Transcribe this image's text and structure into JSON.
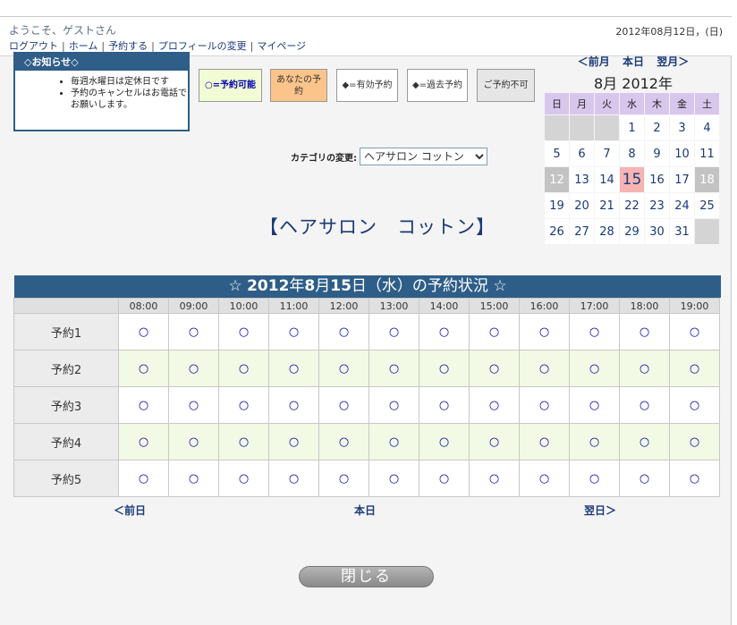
{
  "header": {
    "welcome": "ようこそ、ゲストさん",
    "date": "2012年08月12日，(日)",
    "nav": [
      "ログアウト",
      "ホーム",
      "予約する",
      "プロフィールの変更",
      "マイページ"
    ]
  },
  "notice": {
    "title": "◇お知らせ◇",
    "items": [
      "毎週水曜日は定休日です",
      "予約のキャンセルはお電話でお願いします。"
    ]
  },
  "legend": [
    "○=予約可能",
    "あなたの予約",
    "◆=有効予約",
    "◆=過去予約",
    "ご予約不可"
  ],
  "category": {
    "label": "カテゴリの変更:",
    "selected": "ヘアサロン コットン"
  },
  "salon_name": "【ヘアサロン　コットン】",
  "calendar": {
    "prev": "＜前月",
    "current": "本日",
    "next": "翌月＞",
    "title": "8月 2012年",
    "weekdays": [
      "日",
      "月",
      "火",
      "水",
      "木",
      "金",
      "土"
    ],
    "weeks": [
      [
        "",
        "",
        "",
        "1",
        "2",
        "3",
        "4"
      ],
      [
        "5",
        "6",
        "7",
        "8",
        "9",
        "10",
        "11"
      ],
      [
        "12",
        "13",
        "14",
        "15",
        "16",
        "17",
        "18"
      ],
      [
        "19",
        "20",
        "21",
        "22",
        "23",
        "24",
        "25"
      ],
      [
        "26",
        "27",
        "28",
        "29",
        "30",
        "31",
        ""
      ]
    ],
    "today": "15",
    "grayed": [
      "12",
      "18"
    ]
  },
  "schedule": {
    "title_prefix": "☆ ",
    "title_year": "2012",
    "title_mid1": "年",
    "title_month": "8",
    "title_mid2": "月",
    "title_day": "15",
    "title_suffix": "日（水）の予約状況 ☆",
    "times": [
      "08:00",
      "09:00",
      "10:00",
      "11:00",
      "12:00",
      "13:00",
      "14:00",
      "15:00",
      "16:00",
      "17:00",
      "18:00",
      "19:00"
    ],
    "rows": [
      "予約1",
      "予約2",
      "予約3",
      "予約4",
      "予約5"
    ],
    "slot_mark": "○"
  },
  "day_nav": {
    "prev": "＜前日",
    "current": "本日",
    "next": "翌日＞"
  },
  "close_button": "閉じる"
}
